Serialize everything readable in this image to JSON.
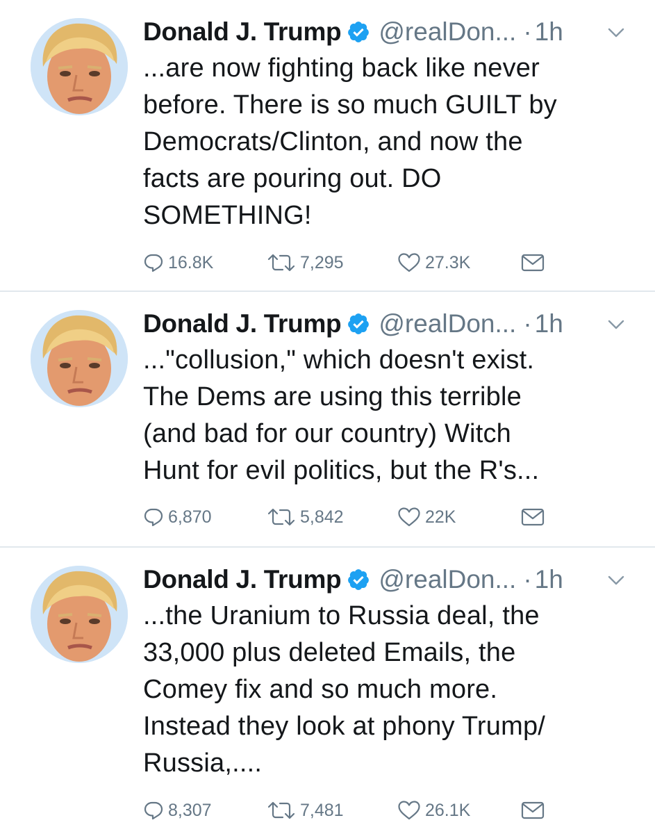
{
  "colors": {
    "name_text": "#14171a",
    "meta_text": "#657786",
    "verified_blue": "#1da1f2",
    "divider": "#e1e8ed",
    "icon_gray": "#657786"
  },
  "tweets": [
    {
      "name": "Donald J. Trump",
      "handle": "@realDon...",
      "dot": "·",
      "time": "1h",
      "text": "...are now fighting back like never\nbefore. There is so much GUILT by\nDemocrats/Clinton, and now the\nfacts are pouring out. DO\nSOMETHING!",
      "replies": "16.8K",
      "retweets": "7,295",
      "likes": "27.3K"
    },
    {
      "name": "Donald J. Trump",
      "handle": "@realDon...",
      "dot": "·",
      "time": "1h",
      "text": "...\"collusion,\" which doesn't exist.\nThe Dems are using this terrible\n(and bad for our country) Witch\nHunt for evil politics, but the R's...",
      "replies": "6,870",
      "retweets": "5,842",
      "likes": "22K"
    },
    {
      "name": "Donald J. Trump",
      "handle": "@realDon...",
      "dot": "·",
      "time": "1h",
      "text": "...the Uranium to Russia deal, the\n33,000 plus deleted Emails, the\nComey fix and so much more.\nInstead they look at phony Trump/\nRussia,....",
      "replies": "8,307",
      "retweets": "7,481",
      "likes": "26.1K"
    }
  ],
  "icons": {
    "avatar": "profile-photo",
    "verified": "verified-badge-icon",
    "caret": "chevron-down-icon",
    "reply": "reply-bubble-icon",
    "retweet": "retweet-icon",
    "like": "heart-icon",
    "dm": "envelope-icon"
  }
}
